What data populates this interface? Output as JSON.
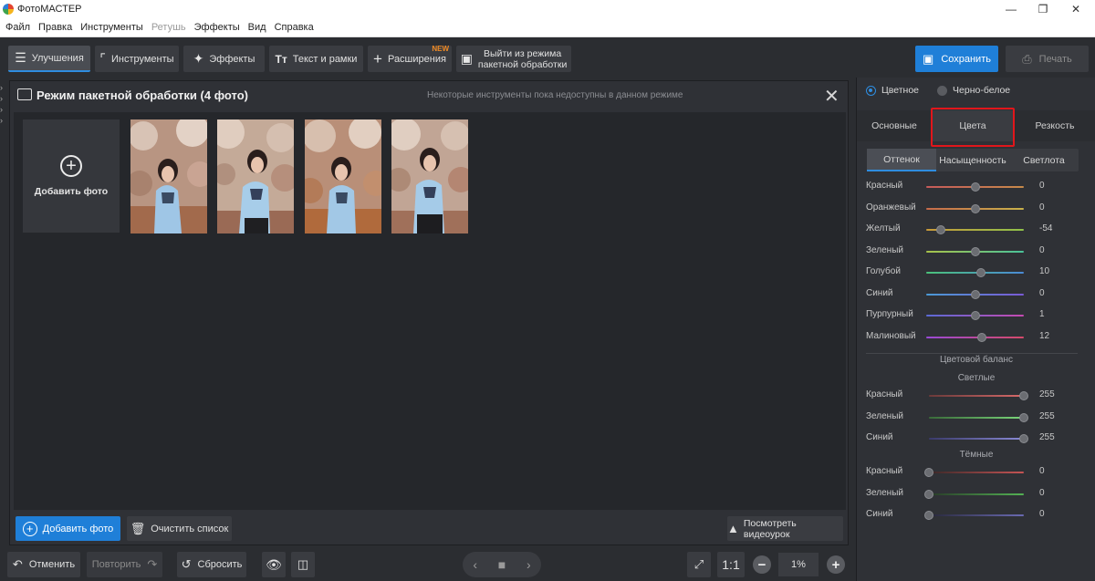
{
  "app": {
    "title": "ФотоМАСТЕР"
  },
  "menu": [
    "Файл",
    "Правка",
    "Инструменты",
    "Ретушь",
    "Эффекты",
    "Вид",
    "Справка"
  ],
  "toolbar": {
    "improve": "Улучшения",
    "tools": "Инструменты",
    "effects": "Эффекты",
    "text_frames": "Текст и рамки",
    "extensions": "Расширения",
    "new_badge": "NEW",
    "exit_batch_line1": "Выйти из режима",
    "exit_batch_line2": "пакетной обработки",
    "save": "Сохранить",
    "print": "Печать"
  },
  "batch": {
    "title": "Режим пакетной обработки (4 фото)",
    "note": "Некоторые инструменты пока недоступны в данном режиме",
    "add_tile_label": "Добавить фото",
    "add_button": "Добавить фото",
    "clear_button": "Очистить список",
    "video_button": "Посмотреть видеоурок"
  },
  "bottom": {
    "undo": "Отменить",
    "redo": "Повторить",
    "reset": "Сбросить",
    "ratio": "1:1",
    "zoom": "1%"
  },
  "right": {
    "mode_color": "Цветное",
    "mode_bw": "Черно-белое",
    "tabs": [
      "Основные",
      "Цвета",
      "Резкость"
    ],
    "subtabs": [
      "Оттенок",
      "Насыщенность",
      "Светлота"
    ],
    "hue_sliders": [
      {
        "label": "Красный",
        "value": "0",
        "level": 0.5,
        "c1": "#c65a5a",
        "c2": "#c78a4a"
      },
      {
        "label": "Оранжевый",
        "value": "0",
        "level": 0.5,
        "c1": "#c76a4a",
        "c2": "#c9b24a"
      },
      {
        "label": "Желтый",
        "value": "-54",
        "level": 0.15,
        "c1": "#c99a3a",
        "c2": "#8fc24a"
      },
      {
        "label": "Зеленый",
        "value": "0",
        "level": 0.5,
        "c1": "#a8c24a",
        "c2": "#4ac29a"
      },
      {
        "label": "Голубой",
        "value": "10",
        "level": 0.56,
        "c1": "#4ac27a",
        "c2": "#4a8ad6"
      },
      {
        "label": "Синий",
        "value": "0",
        "level": 0.5,
        "c1": "#4a9ad6",
        "c2": "#7a5ad6"
      },
      {
        "label": "Пурпурный",
        "value": "1",
        "level": 0.5,
        "c1": "#5a6ad6",
        "c2": "#c64ab2"
      },
      {
        "label": "Малиновый",
        "value": "12",
        "level": 0.57,
        "c1": "#9a4ad6",
        "c2": "#d64a6a"
      }
    ],
    "balance_title": "Цветовой баланс",
    "light_title": "Светлые",
    "light_sliders": [
      {
        "label": "Красный",
        "value": "255",
        "level": 1.0,
        "c1": "#6a3a3a",
        "c2": "#d86a6a"
      },
      {
        "label": "Зеленый",
        "value": "255",
        "level": 1.0,
        "c1": "#3a6a3a",
        "c2": "#7ad67a"
      },
      {
        "label": "Синий",
        "value": "255",
        "level": 1.0,
        "c1": "#3a3a6a",
        "c2": "#8a8ad6"
      }
    ],
    "dark_title": "Тёмные",
    "dark_sliders": [
      {
        "label": "Красный",
        "value": "0",
        "level": 0.0,
        "c1": "#3a2828",
        "c2": "#c65454"
      },
      {
        "label": "Зеленый",
        "value": "0",
        "level": 0.0,
        "c1": "#283a28",
        "c2": "#54b254"
      },
      {
        "label": "Синий",
        "value": "0",
        "level": 0.0,
        "c1": "#28283a",
        "c2": "#6a6ab2"
      }
    ]
  },
  "colors": {
    "accent": "#1f7fd8",
    "highlight": "#e1161b"
  }
}
